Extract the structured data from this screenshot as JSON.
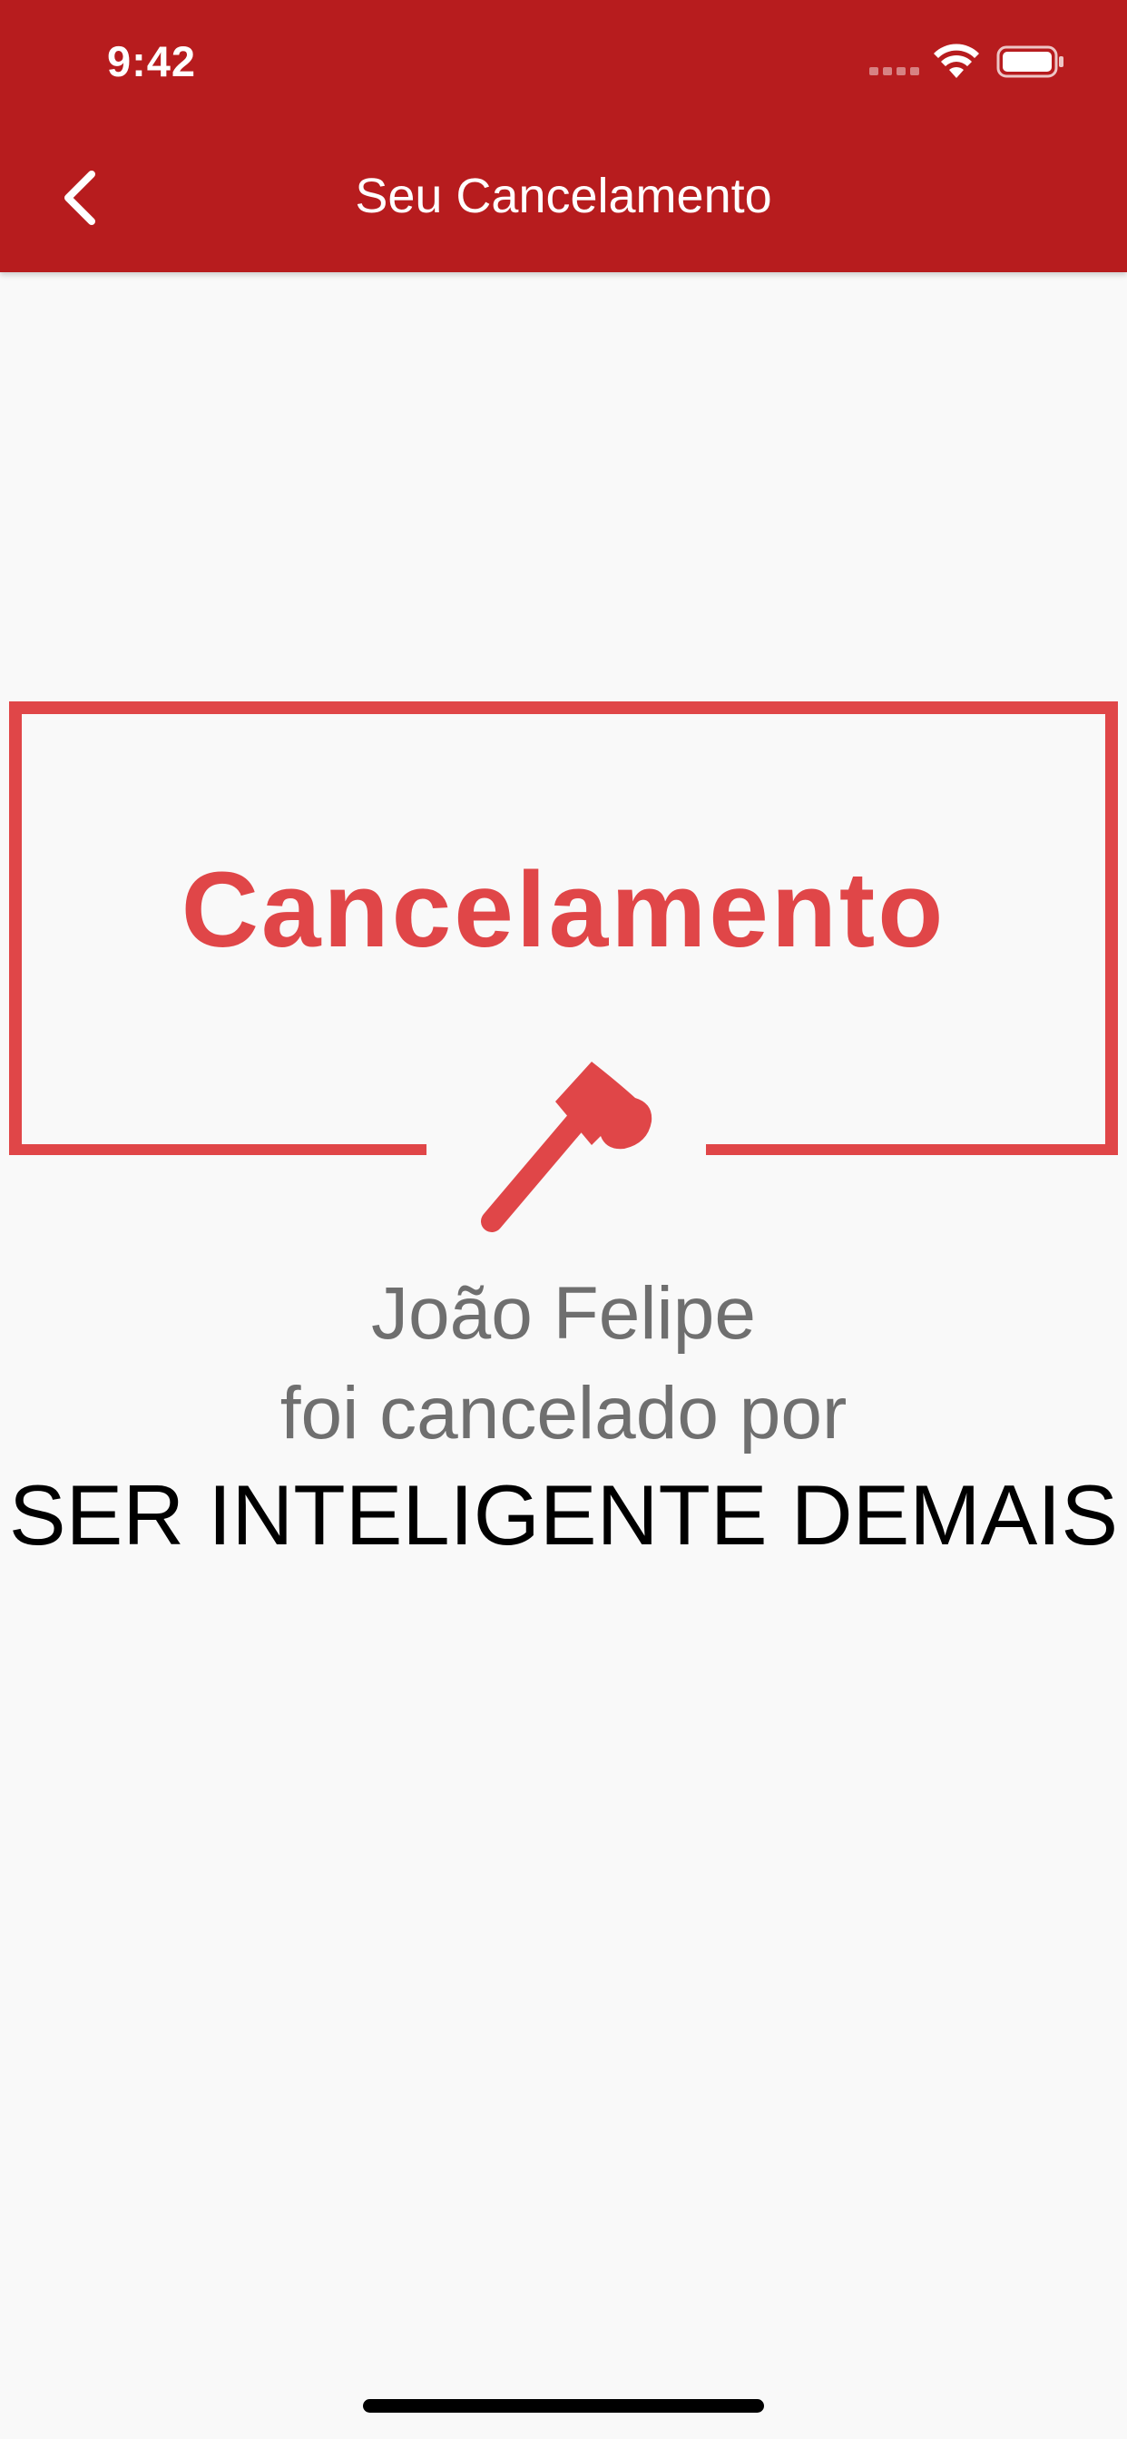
{
  "status_bar": {
    "time": "9:42"
  },
  "nav": {
    "title": "Seu Cancelamento",
    "back_icon": "chevron-left-icon"
  },
  "certificate": {
    "title": "Cancelamento",
    "icon": "axe-icon",
    "person_name": "João Felipe",
    "reason_intro": "foi cancelado por",
    "reason": "SER INTELIGENTE DEMAIS"
  },
  "colors": {
    "header_red": "#b71c1e",
    "accent_red": "#e04648",
    "background": "#f9f9f9",
    "muted_text": "#6f6f6f",
    "emphasis_text": "#000000"
  }
}
